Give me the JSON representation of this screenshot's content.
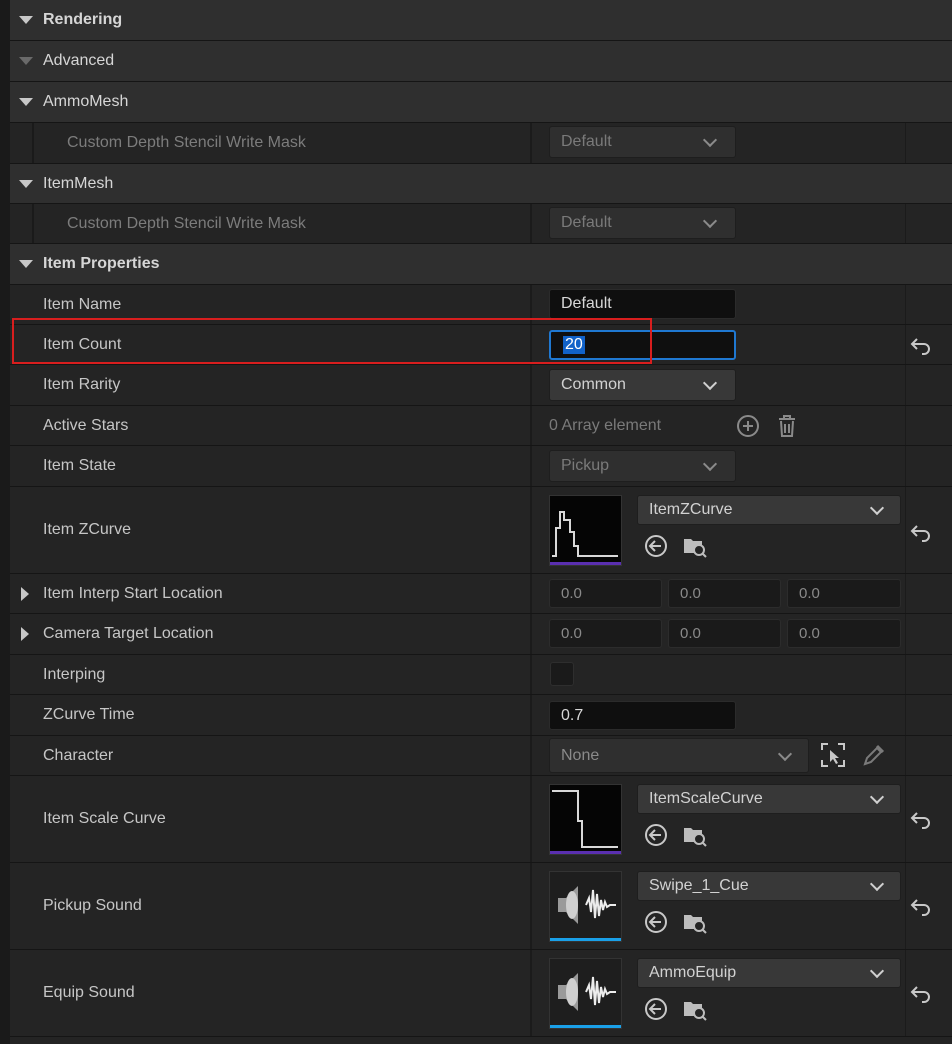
{
  "categories": {
    "rendering": "Rendering",
    "advanced": "Advanced",
    "ammo_mesh": "AmmoMesh",
    "item_mesh": "ItemMesh",
    "item_properties": "Item Properties"
  },
  "ammo_mesh": {
    "label": "Custom Depth Stencil Write Mask",
    "value": "Default"
  },
  "item_mesh": {
    "label": "Custom Depth Stencil Write Mask",
    "value": "Default"
  },
  "props": {
    "item_name": {
      "label": "Item Name",
      "value": "Default"
    },
    "item_count": {
      "label": "Item Count",
      "value": "20"
    },
    "item_rarity": {
      "label": "Item Rarity",
      "value": "Common"
    },
    "active_stars": {
      "label": "Active Stars",
      "value": "0 Array element"
    },
    "item_state": {
      "label": "Item State",
      "value": "Pickup"
    },
    "item_zcurve": {
      "label": "Item ZCurve",
      "value": "ItemZCurve"
    },
    "item_interp_start_location": {
      "label": "Item Interp Start Location",
      "x": "0.0",
      "y": "0.0",
      "z": "0.0"
    },
    "camera_target_location": {
      "label": "Camera Target Location",
      "x": "0.0",
      "y": "0.0",
      "z": "0.0"
    },
    "interping": {
      "label": "Interping",
      "checked": false
    },
    "zcurve_time": {
      "label": "ZCurve Time",
      "value": "0.7"
    },
    "character": {
      "label": "Character",
      "value": "None"
    },
    "item_scale_curve": {
      "label": "Item Scale Curve",
      "value": "ItemScaleCurve"
    },
    "pickup_sound": {
      "label": "Pickup Sound",
      "value": "Swipe_1_Cue"
    },
    "equip_sound": {
      "label": "Equip Sound",
      "value": "AmmoEquip"
    }
  },
  "colors": {
    "highlight": "#d81e1e",
    "focus": "#1f78d1",
    "curve_bar": "#5a2fb0",
    "sound_bar": "#1aa0e8"
  }
}
